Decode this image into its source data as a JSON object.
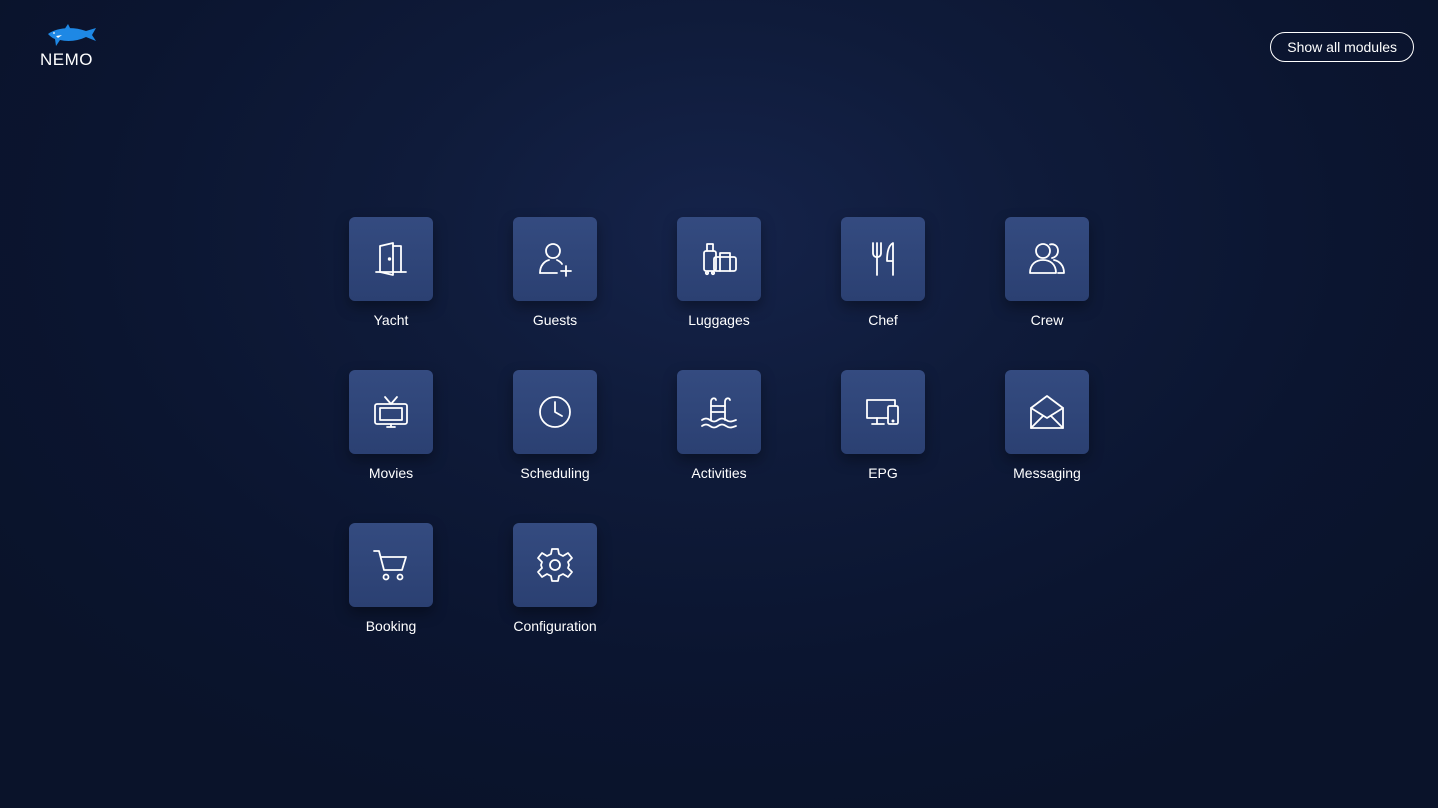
{
  "header": {
    "logo_text": "NEMO",
    "show_all_label": "Show all modules"
  },
  "colors": {
    "background": "#0f1b3a",
    "tile": "#334a7e",
    "logo_accent": "#1e88e5"
  },
  "modules": [
    {
      "label": "Yacht",
      "icon": "door-icon"
    },
    {
      "label": "Guests",
      "icon": "user-add-icon"
    },
    {
      "label": "Luggages",
      "icon": "luggage-icon"
    },
    {
      "label": "Chef",
      "icon": "fork-knife-icon"
    },
    {
      "label": "Crew",
      "icon": "users-icon"
    },
    {
      "label": "Movies",
      "icon": "tv-icon"
    },
    {
      "label": "Scheduling",
      "icon": "clock-icon"
    },
    {
      "label": "Activities",
      "icon": "pool-ladder-icon"
    },
    {
      "label": "EPG",
      "icon": "devices-icon"
    },
    {
      "label": "Messaging",
      "icon": "envelope-open-icon"
    },
    {
      "label": "Booking",
      "icon": "cart-icon"
    },
    {
      "label": "Configuration",
      "icon": "gear-icon"
    }
  ]
}
